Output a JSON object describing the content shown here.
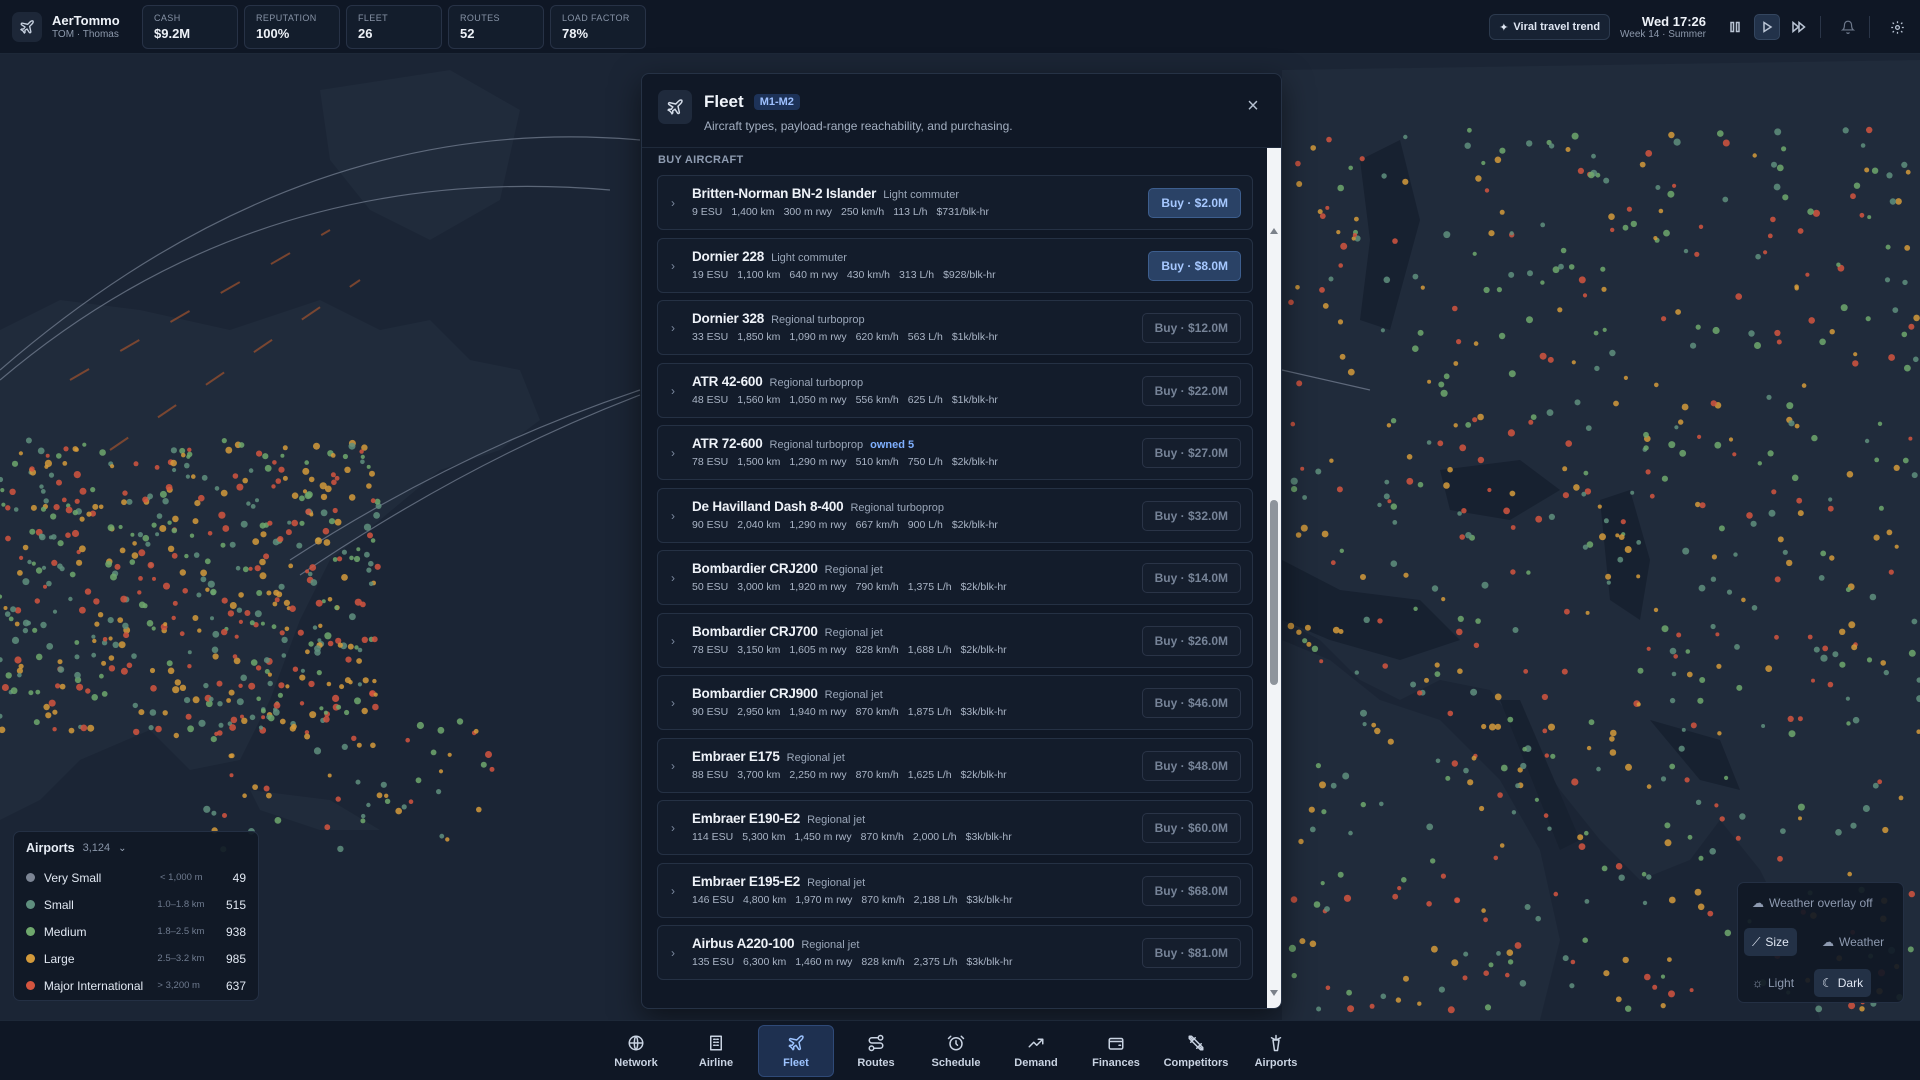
{
  "app": {
    "name": "AerTommo",
    "user": "TOM · Thomas"
  },
  "stats": [
    {
      "label": "CASH",
      "value": "$9.2M"
    },
    {
      "label": "REPUTATION",
      "value": "100%"
    },
    {
      "label": "FLEET",
      "value": "26"
    },
    {
      "label": "ROUTES",
      "value": "52"
    },
    {
      "label": "LOAD FACTOR",
      "value": "78%"
    }
  ],
  "topbar": {
    "trend_label": "Viral travel trend",
    "time": "Wed 17:26",
    "week": "Week 14 · Summer",
    "icons": [
      "pause-icon",
      "play-icon",
      "fast-forward-icon",
      "bell-icon",
      "gear-icon"
    ]
  },
  "fleet_panel": {
    "title": "Fleet",
    "badge": "M1-M2",
    "subtitle": "Aircraft types, payload-range reachability, and purchasing.",
    "section_label": "BUY AIRCRAFT",
    "aircraft": [
      {
        "name": "Britten-Norman BN-2 Islander",
        "class": "Light commuter",
        "owned": "",
        "specs": [
          "9 ESU",
          "1,400 km",
          "300 m rwy",
          "250 km/h",
          "113 L/h",
          "$731/blk-hr"
        ],
        "buy": "Buy · $2.0M",
        "affordable": true
      },
      {
        "name": "Dornier 228",
        "class": "Light commuter",
        "owned": "",
        "specs": [
          "19 ESU",
          "1,100 km",
          "640 m rwy",
          "430 km/h",
          "313 L/h",
          "$928/blk-hr"
        ],
        "buy": "Buy · $8.0M",
        "affordable": true
      },
      {
        "name": "Dornier 328",
        "class": "Regional turboprop",
        "owned": "",
        "specs": [
          "33 ESU",
          "1,850 km",
          "1,090 m rwy",
          "620 km/h",
          "563 L/h",
          "$1k/blk-hr"
        ],
        "buy": "Buy · $12.0M",
        "affordable": false
      },
      {
        "name": "ATR 42-600",
        "class": "Regional turboprop",
        "owned": "",
        "specs": [
          "48 ESU",
          "1,560 km",
          "1,050 m rwy",
          "556 km/h",
          "625 L/h",
          "$1k/blk-hr"
        ],
        "buy": "Buy · $22.0M",
        "affordable": false
      },
      {
        "name": "ATR 72-600",
        "class": "Regional turboprop",
        "owned": "owned 5",
        "specs": [
          "78 ESU",
          "1,500 km",
          "1,290 m rwy",
          "510 km/h",
          "750 L/h",
          "$2k/blk-hr"
        ],
        "buy": "Buy · $27.0M",
        "affordable": false
      },
      {
        "name": "De Havilland Dash 8-400",
        "class": "Regional turboprop",
        "owned": "",
        "specs": [
          "90 ESU",
          "2,040 km",
          "1,290 m rwy",
          "667 km/h",
          "900 L/h",
          "$2k/blk-hr"
        ],
        "buy": "Buy · $32.0M",
        "affordable": false
      },
      {
        "name": "Bombardier CRJ200",
        "class": "Regional jet",
        "owned": "",
        "specs": [
          "50 ESU",
          "3,000 km",
          "1,920 m rwy",
          "790 km/h",
          "1,375 L/h",
          "$2k/blk-hr"
        ],
        "buy": "Buy · $14.0M",
        "affordable": false
      },
      {
        "name": "Bombardier CRJ700",
        "class": "Regional jet",
        "owned": "",
        "specs": [
          "78 ESU",
          "3,150 km",
          "1,605 m rwy",
          "828 km/h",
          "1,688 L/h",
          "$2k/blk-hr"
        ],
        "buy": "Buy · $26.0M",
        "affordable": false
      },
      {
        "name": "Bombardier CRJ900",
        "class": "Regional jet",
        "owned": "",
        "specs": [
          "90 ESU",
          "2,950 km",
          "1,940 m rwy",
          "870 km/h",
          "1,875 L/h",
          "$3k/blk-hr"
        ],
        "buy": "Buy · $46.0M",
        "affordable": false
      },
      {
        "name": "Embraer E175",
        "class": "Regional jet",
        "owned": "",
        "specs": [
          "88 ESU",
          "3,700 km",
          "2,250 m rwy",
          "870 km/h",
          "1,625 L/h",
          "$2k/blk-hr"
        ],
        "buy": "Buy · $48.0M",
        "affordable": false
      },
      {
        "name": "Embraer E190-E2",
        "class": "Regional jet",
        "owned": "",
        "specs": [
          "114 ESU",
          "5,300 km",
          "1,450 m rwy",
          "870 km/h",
          "2,000 L/h",
          "$3k/blk-hr"
        ],
        "buy": "Buy · $60.0M",
        "affordable": false
      },
      {
        "name": "Embraer E195-E2",
        "class": "Regional jet",
        "owned": "",
        "specs": [
          "146 ESU",
          "4,800 km",
          "1,970 m rwy",
          "870 km/h",
          "2,188 L/h",
          "$3k/blk-hr"
        ],
        "buy": "Buy · $68.0M",
        "affordable": false
      },
      {
        "name": "Airbus A220-100",
        "class": "Regional jet",
        "owned": "",
        "specs": [
          "135 ESU",
          "6,300 km",
          "1,460 m rwy",
          "828 km/h",
          "2,375 L/h",
          "$3k/blk-hr"
        ],
        "buy": "Buy · $81.0M",
        "affordable": false
      }
    ]
  },
  "airports_legend": {
    "title": "Airports",
    "count": "3,124",
    "rows": [
      {
        "name": "Very Small",
        "range": "< 1,000 m",
        "value": "49",
        "color": "#7c8594"
      },
      {
        "name": "Small",
        "range": "1.0–1.8 km",
        "value": "515",
        "color": "#5f8f7e"
      },
      {
        "name": "Medium",
        "range": "1.8–2.5 km",
        "value": "938",
        "color": "#6fa86d"
      },
      {
        "name": "Large",
        "range": "2.5–3.2 km",
        "value": "985",
        "color": "#d39a3b"
      },
      {
        "name": "Major International",
        "range": "> 3,200 m",
        "value": "637",
        "color": "#d4553f"
      }
    ]
  },
  "map_controls": {
    "weather_overlay": "Weather overlay off",
    "size": "Size",
    "weather": "Weather",
    "light": "Light",
    "dark": "Dark"
  },
  "bottom_nav": [
    {
      "label": "Network",
      "icon": "globe-icon",
      "active": false
    },
    {
      "label": "Airline",
      "icon": "building-icon",
      "active": false
    },
    {
      "label": "Fleet",
      "icon": "plane-icon",
      "active": true
    },
    {
      "label": "Routes",
      "icon": "route-icon",
      "active": false
    },
    {
      "label": "Schedule",
      "icon": "clock-icon",
      "active": false
    },
    {
      "label": "Demand",
      "icon": "trend-icon",
      "active": false
    },
    {
      "label": "Finances",
      "icon": "wallet-icon",
      "active": false
    },
    {
      "label": "Competitors",
      "icon": "swords-icon",
      "active": false
    },
    {
      "label": "Airports",
      "icon": "tower-icon",
      "active": false
    }
  ],
  "colors": {
    "airport_small": "#5f8f7e",
    "airport_medium": "#6fa86d",
    "airport_large": "#d39a3b",
    "airport_major": "#d4553f",
    "accent": "#9dc3ff"
  }
}
